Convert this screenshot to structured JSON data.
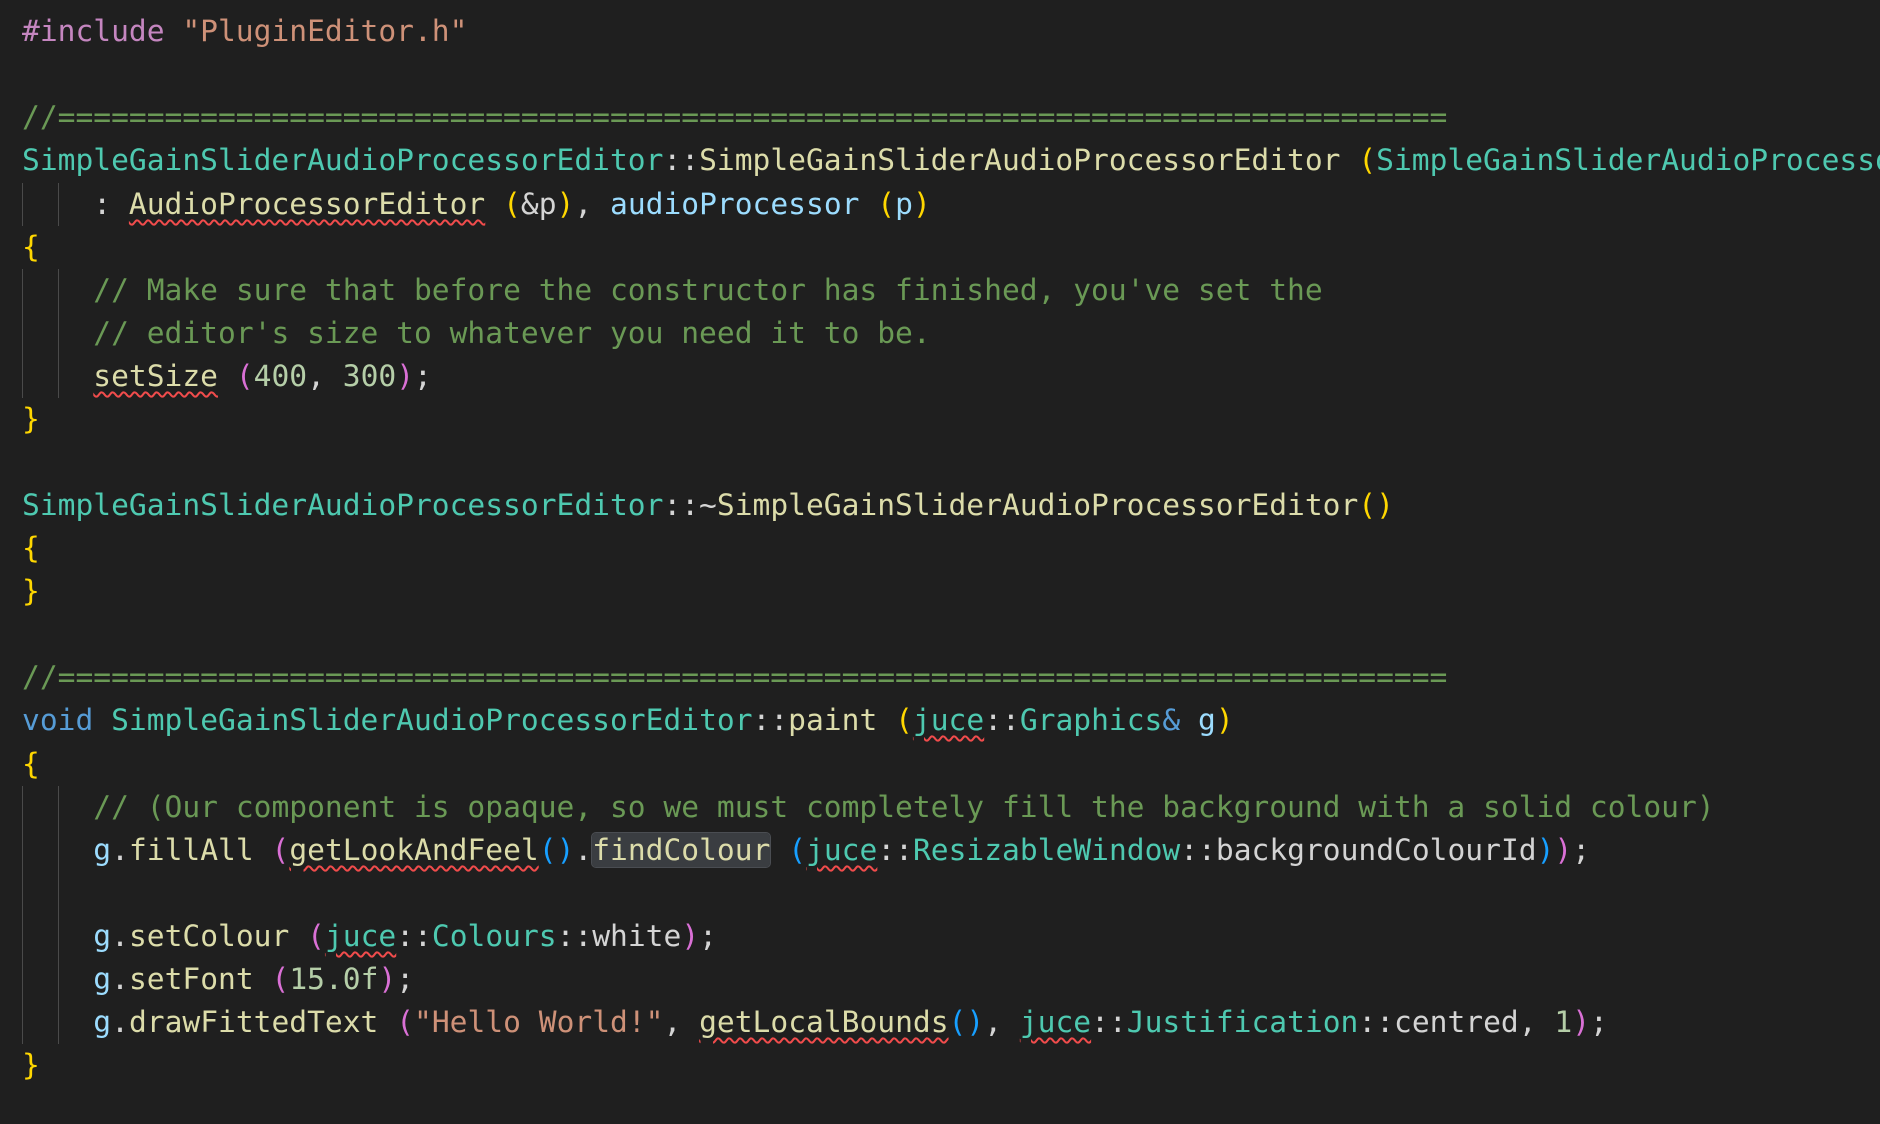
{
  "editor": {
    "lines": {
      "l1": [
        {
          "t": "#include ",
          "c": "kw-include"
        },
        {
          "t": "\"PluginEditor.h\"",
          "c": "str"
        }
      ],
      "l2": [],
      "l3": [
        {
          "t": "//==============================================================================",
          "c": "cm"
        }
      ],
      "l4": [
        {
          "t": "SimpleGainSliderAudioProcessorEditor",
          "c": "cls"
        },
        {
          "t": "::",
          "c": "pl"
        },
        {
          "t": "SimpleGainSliderAudioProcessorEditor",
          "c": "fn"
        },
        {
          "t": " ",
          "c": "pl"
        },
        {
          "t": "(",
          "c": "b1"
        },
        {
          "t": "SimpleGainSliderAudioProcessor",
          "c": "cls"
        },
        {
          "t": "&",
          "c": "pl"
        }
      ],
      "l5": [
        {
          "t": "    : ",
          "c": "pl"
        },
        {
          "t": "AudioProcessorEditor",
          "c": "fn squig"
        },
        {
          "t": " ",
          "c": "pl"
        },
        {
          "t": "(",
          "c": "b1"
        },
        {
          "t": "&p",
          "c": "pl"
        },
        {
          "t": ")",
          "c": "b1"
        },
        {
          "t": ", ",
          "c": "pl"
        },
        {
          "t": "audioProcessor",
          "c": "var"
        },
        {
          "t": " ",
          "c": "pl"
        },
        {
          "t": "(",
          "c": "b1"
        },
        {
          "t": "p",
          "c": "var"
        },
        {
          "t": ")",
          "c": "b1"
        }
      ],
      "l6": [
        {
          "t": "{",
          "c": "b1"
        }
      ],
      "l7": [
        {
          "t": "    ",
          "c": "pl"
        },
        {
          "t": "// Make sure that before the constructor has finished, you've set the",
          "c": "cm"
        }
      ],
      "l8": [
        {
          "t": "    ",
          "c": "pl"
        },
        {
          "t": "// editor's size to whatever you need it to be.",
          "c": "cm"
        }
      ],
      "l9": [
        {
          "t": "    ",
          "c": "pl"
        },
        {
          "t": "setSize",
          "c": "fn squig"
        },
        {
          "t": " ",
          "c": "pl"
        },
        {
          "t": "(",
          "c": "b2"
        },
        {
          "t": "400",
          "c": "num"
        },
        {
          "t": ", ",
          "c": "pl"
        },
        {
          "t": "300",
          "c": "num"
        },
        {
          "t": ")",
          "c": "b2"
        },
        {
          "t": ";",
          "c": "pl"
        }
      ],
      "l10": [
        {
          "t": "}",
          "c": "b1"
        }
      ],
      "l11": [],
      "l12": [
        {
          "t": "SimpleGainSliderAudioProcessorEditor",
          "c": "cls"
        },
        {
          "t": "::~",
          "c": "pl"
        },
        {
          "t": "SimpleGainSliderAudioProcessorEditor",
          "c": "fn"
        },
        {
          "t": "()",
          "c": "b1"
        }
      ],
      "l13": [
        {
          "t": "{",
          "c": "b1"
        }
      ],
      "l14": [
        {
          "t": "}",
          "c": "b1"
        }
      ],
      "l15": [],
      "l16": [
        {
          "t": "//==============================================================================",
          "c": "cm"
        }
      ],
      "l17": [
        {
          "t": "void",
          "c": "kw"
        },
        {
          "t": " ",
          "c": "pl"
        },
        {
          "t": "SimpleGainSliderAudioProcessorEditor",
          "c": "cls"
        },
        {
          "t": "::",
          "c": "pl"
        },
        {
          "t": "paint",
          "c": "fn"
        },
        {
          "t": " ",
          "c": "pl"
        },
        {
          "t": "(",
          "c": "b1"
        },
        {
          "t": "juce",
          "c": "cls squig"
        },
        {
          "t": "::",
          "c": "pl"
        },
        {
          "t": "Graphics",
          "c": "cls"
        },
        {
          "t": "&",
          "c": "kw"
        },
        {
          "t": " ",
          "c": "pl"
        },
        {
          "t": "g",
          "c": "var"
        },
        {
          "t": ")",
          "c": "b1"
        }
      ],
      "l18": [
        {
          "t": "{",
          "c": "b1"
        }
      ],
      "l19": [
        {
          "t": "    ",
          "c": "pl"
        },
        {
          "t": "// (Our component is opaque, so we must completely fill the background with a solid colour)",
          "c": "cm"
        }
      ],
      "l20": [
        {
          "t": "    ",
          "c": "pl"
        },
        {
          "t": "g",
          "c": "var"
        },
        {
          "t": ".",
          "c": "pl"
        },
        {
          "t": "fillAll",
          "c": "fn"
        },
        {
          "t": " ",
          "c": "pl"
        },
        {
          "t": "(",
          "c": "b2"
        },
        {
          "t": "getLookAndFeel",
          "c": "fn squig"
        },
        {
          "t": "()",
          "c": "b3"
        },
        {
          "t": ".",
          "c": "pl"
        },
        {
          "t": "findColour",
          "c": "fn hl"
        },
        {
          "t": " ",
          "c": "pl"
        },
        {
          "t": "(",
          "c": "b3"
        },
        {
          "t": "juce",
          "c": "cls squig"
        },
        {
          "t": "::",
          "c": "pl"
        },
        {
          "t": "ResizableWindow",
          "c": "cls"
        },
        {
          "t": "::",
          "c": "pl"
        },
        {
          "t": "backgroundColourId",
          "c": "pl"
        },
        {
          "t": ")",
          "c": "b3"
        },
        {
          "t": ")",
          "c": "b2"
        },
        {
          "t": ";",
          "c": "pl"
        }
      ],
      "l21": [],
      "l22": [
        {
          "t": "    ",
          "c": "pl"
        },
        {
          "t": "g",
          "c": "var"
        },
        {
          "t": ".",
          "c": "pl"
        },
        {
          "t": "setColour",
          "c": "fn"
        },
        {
          "t": " ",
          "c": "pl"
        },
        {
          "t": "(",
          "c": "b2"
        },
        {
          "t": "juce",
          "c": "cls squig"
        },
        {
          "t": "::",
          "c": "pl"
        },
        {
          "t": "Colours",
          "c": "cls"
        },
        {
          "t": "::",
          "c": "pl"
        },
        {
          "t": "white",
          "c": "pl"
        },
        {
          "t": ")",
          "c": "b2"
        },
        {
          "t": ";",
          "c": "pl"
        }
      ],
      "l23": [
        {
          "t": "    ",
          "c": "pl"
        },
        {
          "t": "g",
          "c": "var"
        },
        {
          "t": ".",
          "c": "pl"
        },
        {
          "t": "setFont",
          "c": "fn"
        },
        {
          "t": " ",
          "c": "pl"
        },
        {
          "t": "(",
          "c": "b2"
        },
        {
          "t": "15.0f",
          "c": "num"
        },
        {
          "t": ")",
          "c": "b2"
        },
        {
          "t": ";",
          "c": "pl"
        }
      ],
      "l24": [
        {
          "t": "    ",
          "c": "pl"
        },
        {
          "t": "g",
          "c": "var"
        },
        {
          "t": ".",
          "c": "pl"
        },
        {
          "t": "drawFittedText",
          "c": "fn"
        },
        {
          "t": " ",
          "c": "pl"
        },
        {
          "t": "(",
          "c": "b2"
        },
        {
          "t": "\"Hello World!\"",
          "c": "str"
        },
        {
          "t": ", ",
          "c": "pl"
        },
        {
          "t": "getLocalBounds",
          "c": "fn squig"
        },
        {
          "t": "()",
          "c": "b3"
        },
        {
          "t": ", ",
          "c": "pl"
        },
        {
          "t": "juce",
          "c": "cls squig"
        },
        {
          "t": "::",
          "c": "pl"
        },
        {
          "t": "Justification",
          "c": "cls"
        },
        {
          "t": "::",
          "c": "pl"
        },
        {
          "t": "centred",
          "c": "pl"
        },
        {
          "t": ", ",
          "c": "pl"
        },
        {
          "t": "1",
          "c": "num"
        },
        {
          "t": ")",
          "c": "b2"
        },
        {
          "t": ";",
          "c": "pl"
        }
      ],
      "l25": [
        {
          "t": "}",
          "c": "b1"
        }
      ]
    }
  }
}
